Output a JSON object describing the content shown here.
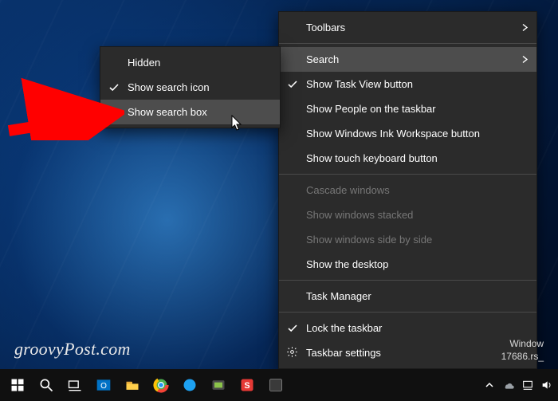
{
  "main_menu": {
    "toolbars": "Toolbars",
    "search": "Search",
    "task_view": "Show Task View button",
    "people": "Show People on the taskbar",
    "ink": "Show Windows Ink Workspace button",
    "touch_kb": "Show touch keyboard button",
    "cascade": "Cascade windows",
    "stacked": "Show windows stacked",
    "side": "Show windows side by side",
    "desktop": "Show the desktop",
    "task_mgr": "Task Manager",
    "lock": "Lock the taskbar",
    "settings": "Taskbar settings"
  },
  "search_menu": {
    "hidden": "Hidden",
    "icon": "Show search icon",
    "box": "Show search box"
  },
  "build": {
    "line1": "Window",
    "line2": "17686.rs_"
  },
  "watermark": "groovyPost.com"
}
